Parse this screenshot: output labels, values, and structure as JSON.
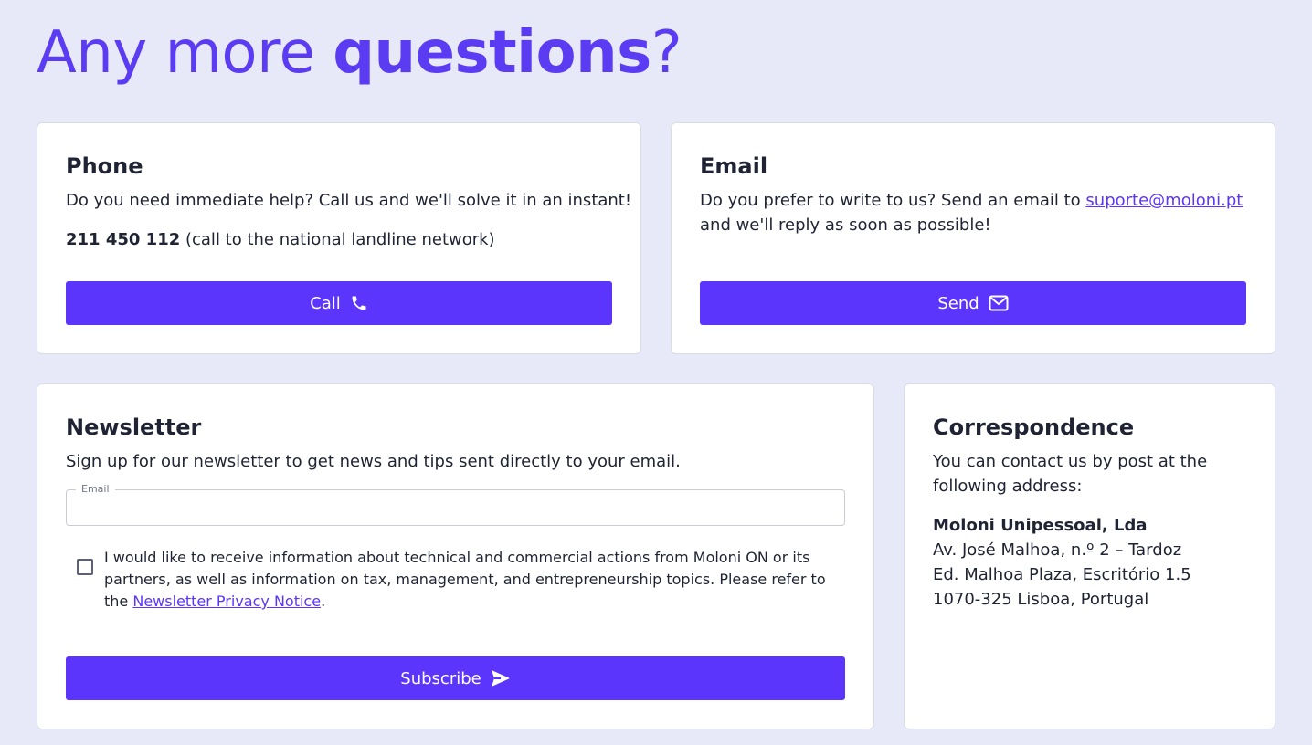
{
  "headline": {
    "regular": "Any more ",
    "bold": "questions",
    "end": "?"
  },
  "phone": {
    "title": "Phone",
    "description": "Do you need immediate help? Call us and we'll solve it in an instant!",
    "number": "211 450 112",
    "number_note": " (call to the national landline network)",
    "button_label": "Call",
    "button_icon": "phone-icon"
  },
  "email": {
    "title": "Email",
    "description_before": "Do you prefer to write to us? Send an email to ",
    "address": "suporte@moloni.pt",
    "description_after": " and we'll reply as soon as possible!",
    "button_label": "Send",
    "button_icon": "envelope-icon"
  },
  "newsletter": {
    "title": "Newsletter",
    "description": "Sign up for our newsletter to get news and tips sent directly to your email.",
    "email_label": "Email",
    "email_value": "",
    "consent_before": "I would like to receive information about technical and commercial actions from Moloni ON or its partners, as well as information on tax, management, and entrepreneurship topics. Please refer to the ",
    "consent_link": "Newsletter Privacy Notice",
    "consent_after": ".",
    "consent_checked": false,
    "button_label": "Subscribe",
    "button_icon": "paper-plane-icon"
  },
  "correspondence": {
    "title": "Correspondence",
    "description": "You can contact us by post at the following address:",
    "company": "Moloni Unipessoal, Lda",
    "address_lines": [
      "Av. José Malhoa, n.º 2 – Tardoz",
      "Ed. Malhoa Plaza, Escritório 1.5",
      "1070-325 Lisboa, Portugal"
    ]
  },
  "colors": {
    "accent": "#5b35fb",
    "headline": "#5b3cf2",
    "background": "#e8e9f8",
    "card": "#ffffff",
    "text": "#1f2333"
  }
}
